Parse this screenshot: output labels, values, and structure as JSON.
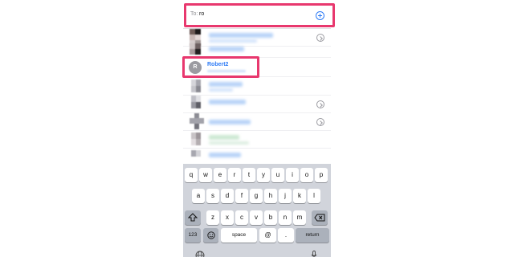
{
  "to_field": {
    "label": "To:",
    "value": "ro"
  },
  "contact": {
    "initial": "R",
    "name": "Robert2"
  },
  "keyboard": {
    "row1": [
      "q",
      "w",
      "e",
      "r",
      "t",
      "y",
      "u",
      "i",
      "o",
      "p"
    ],
    "row2": [
      "a",
      "s",
      "d",
      "f",
      "g",
      "h",
      "j",
      "k",
      "l"
    ],
    "row3": [
      "z",
      "x",
      "c",
      "v",
      "b",
      "n",
      "m"
    ],
    "numbers": "123",
    "space": "space",
    "at": "@",
    "period": ".",
    "return": "return"
  },
  "colors": {
    "accent": "#2f7cf6",
    "highlight": "#e8386e",
    "keyboard_bg": "#d1d4db"
  },
  "icons": [
    "plus-circle-icon",
    "chevron-right-icon",
    "shift-icon",
    "delete-icon",
    "emoji-icon",
    "globe-icon",
    "microphone-icon"
  ]
}
